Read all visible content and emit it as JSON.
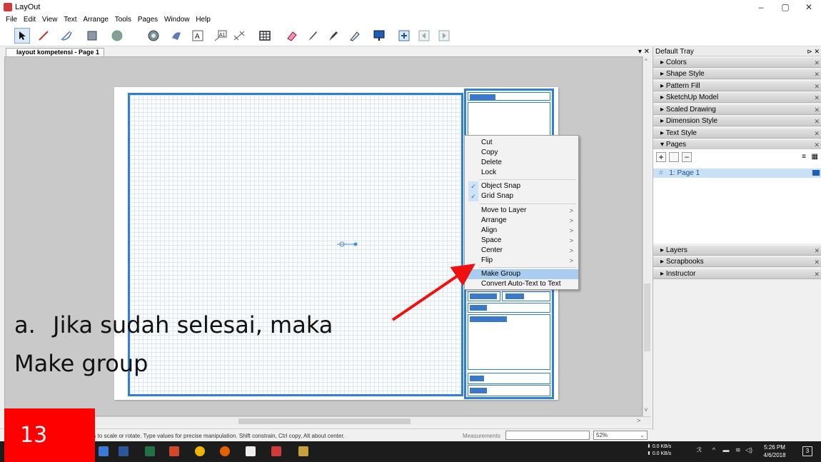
{
  "window": {
    "title": "LayOut",
    "min": "–",
    "max": "▢",
    "close": "✕"
  },
  "menu": [
    "File",
    "Edit",
    "View",
    "Text",
    "Arrange",
    "Tools",
    "Pages",
    "Window",
    "Help"
  ],
  "tab": {
    "label": "layout kompetensi - Page 1",
    "buttons": "▾ ✕"
  },
  "context_menu": {
    "items": [
      "Cut",
      "Copy",
      "Delete",
      "Lock",
      "Object Snap",
      "Grid Snap",
      "Move to Layer",
      "Arrange",
      "Align",
      "Space",
      "Center",
      "Flip",
      "Make Group",
      "Convert Auto-Text to Text"
    ],
    "checked": [
      "Object Snap",
      "Grid Snap"
    ],
    "highlighted": "Make Group"
  },
  "tray": {
    "title": "Default Tray",
    "head_buttons": "⊳ ✕",
    "panels": [
      "Colors",
      "Shape Style",
      "Pattern Fill",
      "SketchUp Model",
      "Scaled Drawing",
      "Dimension Style",
      "Text Style",
      "Pages"
    ],
    "pages": {
      "page_row": "1: Page 1",
      "page_hash": "#"
    },
    "panels_bottom": [
      "Layers",
      "Scrapbooks",
      "Instructor"
    ]
  },
  "status": {
    "hint": "ps to scale or rotate. Type values for precise manipulation. Shift constrain, Ctrl copy, Alt about center.",
    "measurements_label": "Measurements",
    "measurements_value": "",
    "zoom": "52%"
  },
  "taskbar": {
    "net_down": "0.0 KB/s",
    "net_up": "0.0 KB/s",
    "time": "5:26 PM",
    "date": "4/6/2018",
    "notif_count": "3"
  },
  "overlay": {
    "caption_marker": "a.",
    "caption_line1": "Jika sudah selesai, maka",
    "caption_line2": "Make group",
    "slide_number": "13",
    "arrow_color": "#ee1111"
  },
  "colors": {
    "accent": "#2f7fd9",
    "highlight": "#a9cdf0",
    "badge": "#ff0000"
  }
}
